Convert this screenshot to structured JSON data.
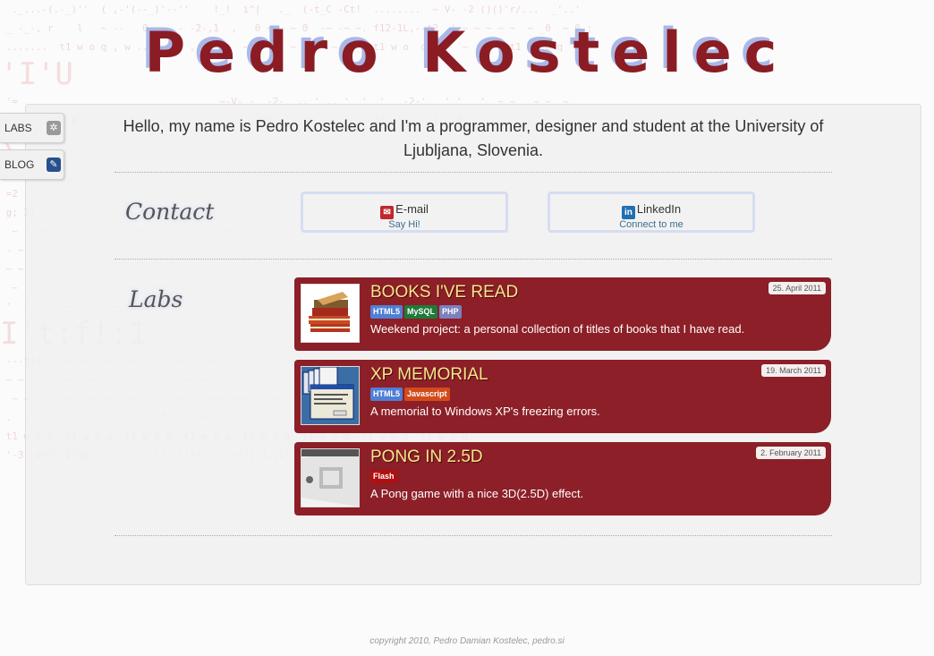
{
  "header": {
    "title": "Pedro Kostelec"
  },
  "intro": {
    "text": "Hello, my name is Pedro Kostelec and I'm a programmer, designer and student at the University of Ljubljana, Slovenia."
  },
  "side_tabs": [
    {
      "label": "LABS",
      "icon": "gear-icon"
    },
    {
      "label": "BLOG",
      "icon": "pencil-icon"
    }
  ],
  "contact": {
    "heading": "Contact",
    "buttons": [
      {
        "label": "E-mail",
        "sub": "Say Hi!",
        "icon": "mail-icon",
        "icon_color": "#c0282b"
      },
      {
        "label": "LinkedIn",
        "sub": "Connect to me",
        "icon": "linkedin-icon",
        "icon_color": "#1f6fb2"
      }
    ]
  },
  "labs": {
    "heading": "Labs",
    "items": [
      {
        "title": "BOOKS I'VE READ",
        "date": "25. April 2011",
        "tags": [
          {
            "label": "HTML5",
            "color": "#4f7fd6"
          },
          {
            "label": "MySQL",
            "color": "#1f7a3a"
          },
          {
            "label": "PHP",
            "color": "#7b80bf"
          }
        ],
        "description": "Weekend project: a personal collection of titles of books that I have read.",
        "thumb": "books-thumbnail"
      },
      {
        "title": "XP MEMORIAL",
        "date": "19. March 2011",
        "tags": [
          {
            "label": "HTML5",
            "color": "#4f7fd6"
          },
          {
            "label": "Javascript",
            "color": "#d24b1a"
          }
        ],
        "description": "A memorial to Windows XP's freezing errors.",
        "thumb": "xp-windows-thumbnail"
      },
      {
        "title": "PONG IN 2.5D",
        "date": "2. February 2011",
        "tags": [
          {
            "label": "Flash",
            "color": "#b01010"
          }
        ],
        "description": "A Pong game with a nice 3D(2.5D) effect.",
        "thumb": "pong-thumbnail"
      }
    ]
  },
  "footer": {
    "text": "copyright 2010, Pedro Damian Kostelec, pedro.si"
  },
  "colors": {
    "accent": "#8c1f27",
    "title_shadow": "#aab8e8",
    "title_yellow": "#f7e58a"
  }
}
